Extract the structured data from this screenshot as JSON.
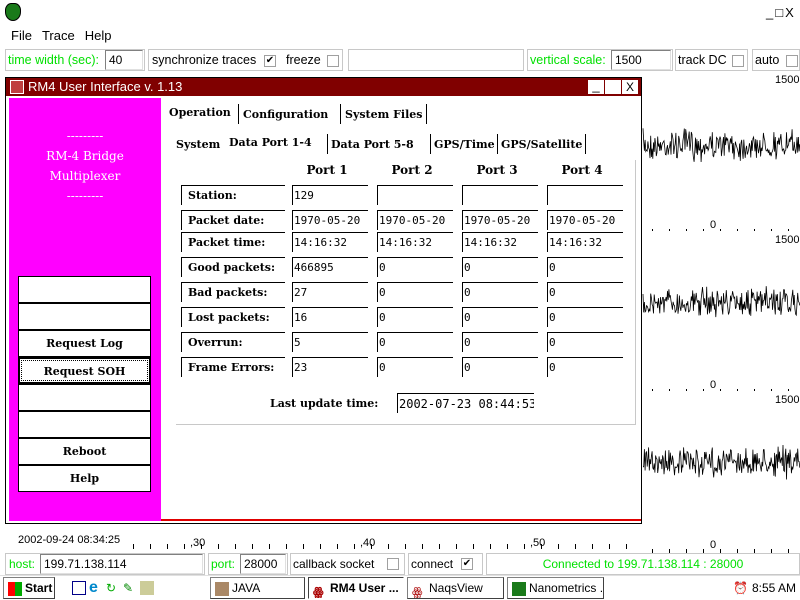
{
  "app": {
    "window_controls": [
      "_",
      "□",
      "X"
    ]
  },
  "menu": [
    "File",
    "Trace",
    "Help"
  ],
  "toolbar": {
    "time_width_label": "time width (sec):",
    "time_width_value": "40",
    "sync_label": "synchronize traces",
    "sync_checked": "✔",
    "freeze_label": "freeze",
    "vertical_scale_label": "vertical scale:",
    "vertical_scale_value": "1500",
    "track_dc_label": "track DC",
    "auto_label": "auto"
  },
  "traces": {
    "scale_labels": [
      "1500",
      "1500",
      "1500"
    ],
    "zero_label": "0"
  },
  "time_axis": {
    "start": "2002-09-24 08:34:25",
    "ticks": [
      ",30",
      ",40",
      ",50",
      "0"
    ]
  },
  "dialog": {
    "title": "RM4 User Interface v. 1.13",
    "controls": [
      "_",
      "",
      "X"
    ],
    "banner": [
      "---------",
      "RM-4 Bridge",
      "Multiplexer",
      "---------"
    ],
    "side_buttons": [
      "",
      "",
      "Request Log",
      "Request SOH",
      "",
      "",
      "Reboot",
      "Help"
    ],
    "tabs": [
      "Operation",
      "Configuration",
      "System Files"
    ],
    "subtabs": [
      "System",
      "Data Port 1-4",
      "Data Port 5-8",
      "GPS/Time",
      "GPS/Satellite"
    ],
    "columns": [
      "Port 1",
      "Port 2",
      "Port 3",
      "Port 4"
    ],
    "rows": [
      {
        "label": "Station:",
        "values": [
          "129",
          "",
          "",
          ""
        ]
      },
      {
        "label": "Packet date:",
        "values": [
          "1970-05-20",
          "1970-05-20",
          "1970-05-20",
          "1970-05-20"
        ]
      },
      {
        "label": "Packet time:",
        "values": [
          "14:16:32",
          "14:16:32",
          "14:16:32",
          "14:16:32"
        ]
      },
      {
        "label": "Good packets:",
        "values": [
          "466895",
          "0",
          "0",
          "0"
        ]
      },
      {
        "label": "Bad packets:",
        "values": [
          "27",
          "0",
          "0",
          "0"
        ]
      },
      {
        "label": "Lost packets:",
        "values": [
          "16",
          "0",
          "0",
          "0"
        ]
      },
      {
        "label": "Overrun:",
        "values": [
          "5",
          "0",
          "0",
          "0"
        ]
      },
      {
        "label": "Frame Errors:",
        "values": [
          "23",
          "0",
          "0",
          "0"
        ]
      }
    ],
    "last_update_label": "Last update time:",
    "last_update_value": "2002-07-23 08:44:53"
  },
  "status": {
    "host_label": "host:",
    "host_value": "199.71.138.114",
    "port_label": "port:",
    "port_value": "28000",
    "callback_label": "callback socket",
    "connect_label": "connect",
    "connect_checked": "✔",
    "message": "Connected to 199.71.138.114 : 28000"
  },
  "taskbar": {
    "start": "Start",
    "tasks": [
      "JAVA",
      "RM4 User ...",
      "NaqsView",
      "Nanometrics ..."
    ],
    "clock": "8:55 AM"
  },
  "colors": {
    "accent_green": "#00e000",
    "dialog_title": "#800000",
    "side_panel": "#ff00ff"
  }
}
